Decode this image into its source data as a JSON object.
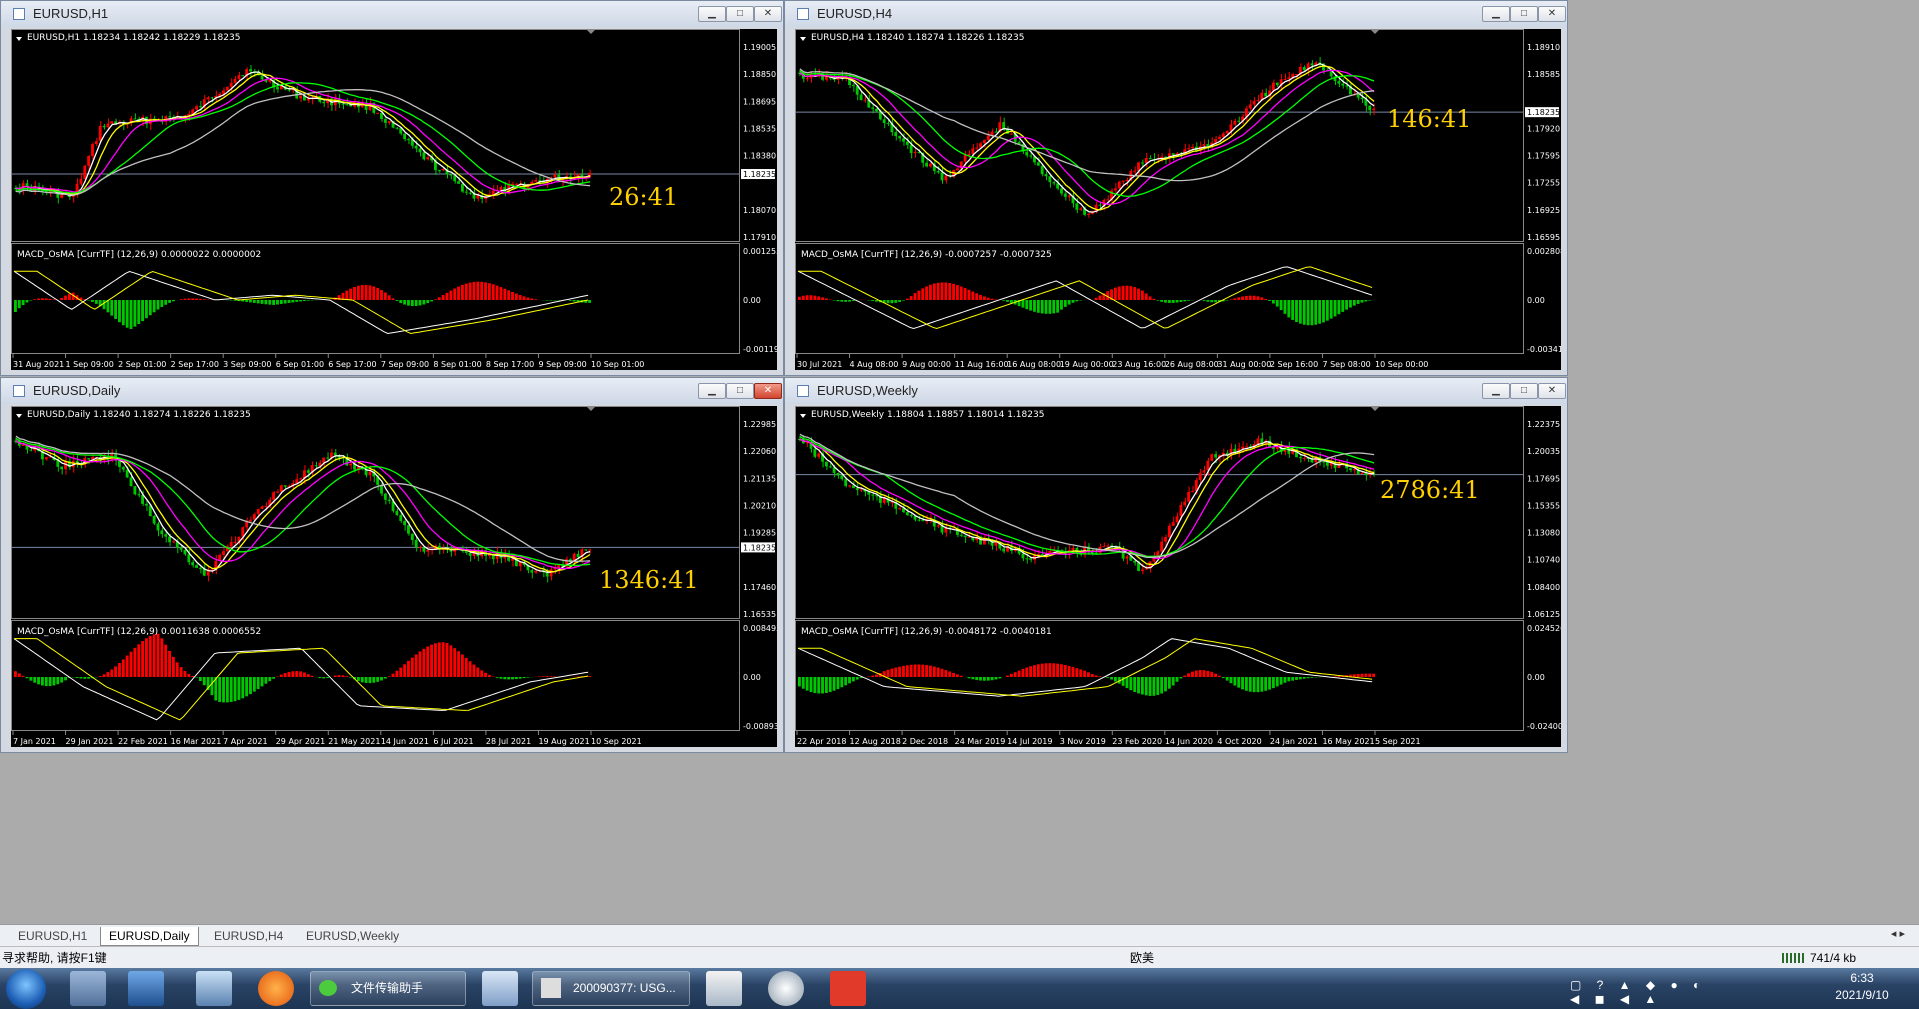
{
  "windows": [
    {
      "id": "h1",
      "title": "EURUSD,H1",
      "symbol_line": "EURUSD,H1  1.18234 1.18242 1.18229 1.18235",
      "timer": "26:41",
      "macd_label": "MACD_OsMA [CurrTF] (12,26,9) 0.0000022 0.0000002",
      "price_labels": [
        "1.19005",
        "1.18850",
        "1.18695",
        "1.18535",
        "1.18380",
        "1.18235",
        "1.18070",
        "1.17910"
      ],
      "current_price": "1.18235",
      "macd_labels": [
        "0.0012553",
        "0.00",
        "-0.0011939"
      ],
      "time_labels": [
        "31 Aug 2021",
        "1 Sep 09:00",
        "2 Sep 01:00",
        "2 Sep 17:00",
        "3 Sep 09:00",
        "6 Sep 01:00",
        "6 Sep 17:00",
        "7 Sep 09:00",
        "8 Sep 01:00",
        "8 Sep 17:00",
        "9 Sep 09:00",
        "10 Sep 01:00"
      ]
    },
    {
      "id": "h4",
      "title": "EURUSD,H4",
      "symbol_line": "EURUSD,H4  1.18240 1.18274 1.18226 1.18235",
      "timer": "146:41",
      "macd_label": "MACD_OsMA [CurrTF] (12,26,9) -0.0007257 -0.0007325",
      "price_labels": [
        "1.18910",
        "1.18585",
        "1.18235",
        "1.17920",
        "1.17595",
        "1.17255",
        "1.16925",
        "1.16595"
      ],
      "current_price": "1.18235",
      "macd_labels": [
        "0.0028083",
        "0.00",
        "-0.0034159"
      ],
      "time_labels": [
        "30 Jul 2021",
        "4 Aug 08:00",
        "9 Aug 00:00",
        "11 Aug 16:00",
        "16 Aug 08:00",
        "19 Aug 00:00",
        "23 Aug 16:00",
        "26 Aug 08:00",
        "31 Aug 00:00",
        "2 Sep 16:00",
        "7 Sep 08:00",
        "10 Sep 00:00"
      ]
    },
    {
      "id": "d1",
      "title": "EURUSD,Daily",
      "symbol_line": "EURUSD,Daily  1.18240 1.18274 1.18226 1.18235",
      "timer": "1346:41",
      "macd_label": "MACD_OsMA [CurrTF] (12,26,9) 0.0011638 0.0006552",
      "price_labels": [
        "1.22985",
        "1.22060",
        "1.21135",
        "1.20210",
        "1.19285",
        "1.18235",
        "1.17460",
        "1.16535"
      ],
      "current_price": "1.18235",
      "macd_labels": [
        "0.0084932",
        "0.00",
        "-0.008936"
      ],
      "time_labels": [
        "7 Jan 2021",
        "29 Jan 2021",
        "22 Feb 2021",
        "16 Mar 2021",
        "7 Apr 2021",
        "29 Apr 2021",
        "21 May 2021",
        "14 Jun 2021",
        "6 Jul 2021",
        "28 Jul 2021",
        "19 Aug 2021",
        "10 Sep 2021"
      ]
    },
    {
      "id": "w1",
      "title": "EURUSD,Weekly",
      "symbol_line": "EURUSD,Weekly  1.18804 1.18857 1.18014 1.18235",
      "timer": "2786:41",
      "macd_label": "MACD_OsMA [CurrTF] (12,26,9) -0.0048172 -0.0040181",
      "price_labels": [
        "1.22375",
        "1.20035",
        "1.17695",
        "1.15355",
        "1.13080",
        "1.10740",
        "1.08400",
        "1.06125"
      ],
      "current_price": "1.18235",
      "macd_labels": [
        "0.0245267",
        "0.00",
        "-0.0240035"
      ],
      "time_labels": [
        "22 Apr 2018",
        "12 Aug 2018",
        "2 Dec 2018",
        "24 Mar 2019",
        "14 Jul 2019",
        "3 Nov 2019",
        "23 Feb 2020",
        "14 Jun 2020",
        "4 Oct 2020",
        "24 Jan 2021",
        "16 May 2021",
        "5 Sep 2021"
      ]
    }
  ],
  "tabs": [
    "EURUSD,H1",
    "EURUSD,Daily",
    "EURUSD,H4",
    "EURUSD,Weekly"
  ],
  "active_tab": "EURUSD,Daily",
  "status": {
    "help": "寻求帮助, 请按F1键",
    "profile": "欧美",
    "traffic": "741/4 kb"
  },
  "taskbar": {
    "buttons": [
      "文件传输助手",
      "200090377: USG..."
    ],
    "time": "6:33",
    "date": "2021/9/10"
  },
  "colors": {
    "bull": "#ff0000",
    "bear": "#00c800",
    "ma_fast": "#ffffff",
    "ma_2": "#ffff00",
    "ma_3": "#ff00ff",
    "ma_4": "#00ff00",
    "ma_5": "#c0c0c0",
    "timer": "#ffd000"
  }
}
